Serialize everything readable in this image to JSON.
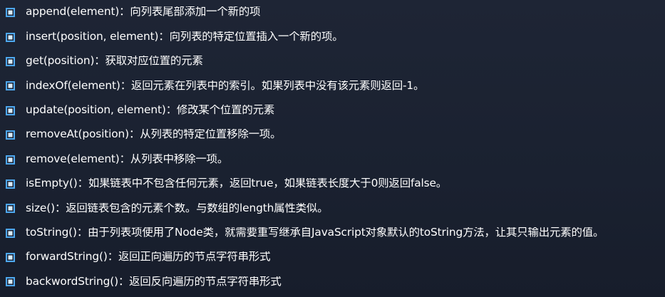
{
  "items": [
    {
      "text": "append(element)：向列表尾部添加一个新的项"
    },
    {
      "text": "insert(position, element)：向列表的特定位置插入一个新的项。"
    },
    {
      "text": "get(position)：获取对应位置的元素"
    },
    {
      "text": "indexOf(element)：返回元素在列表中的索引。如果列表中没有该元素则返回-1。"
    },
    {
      "text": "update(position, element)：修改某个位置的元素"
    },
    {
      "text": "removeAt(position)：从列表的特定位置移除一项。"
    },
    {
      "text": "remove(element)：从列表中移除一项。"
    },
    {
      "text": "isEmpty()：如果链表中不包含任何元素，返回true，如果链表长度大于0则返回false。"
    },
    {
      "text": "size()：返回链表包含的元素个数。与数组的length属性类似。"
    },
    {
      "text": "toString()：由于列表项使用了Node类，就需要重写继承自JavaScript对象默认的toString方法，让其只输出元素的值。"
    },
    {
      "text": "forwardString()：返回正向遍历的节点字符串形式"
    },
    {
      "text": "backwordString()：返回反向遍历的节点字符串形式"
    }
  ],
  "colors": {
    "background": "#1b2231",
    "bullet_border": "#4ea8ef",
    "text": "#ffffff"
  },
  "icons": {
    "bullet": "square-bullet-icon"
  }
}
